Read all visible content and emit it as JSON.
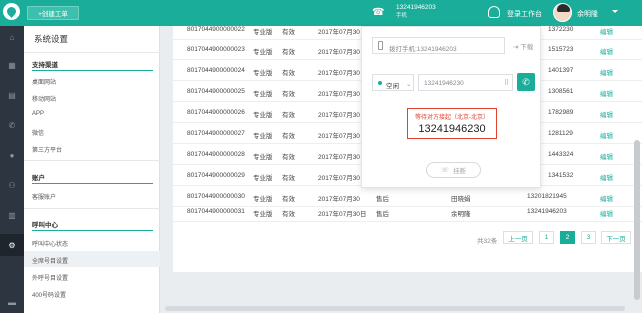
{
  "header": {
    "create_ticket": "+创建工单",
    "phone_number": "13241946203",
    "phone_sub": "手机",
    "login_workbench": "登录工作台",
    "username": "余明隆"
  },
  "settings": {
    "title": "系统设置",
    "sections": [
      {
        "label": "支持渠道",
        "items": [
          "桌面网站",
          "移动网站",
          "APP",
          "微信",
          "第三方平台"
        ]
      },
      {
        "label": "账户",
        "items": [
          "客服账户"
        ]
      },
      {
        "label": "呼叫中心",
        "items": [
          "呼叫中心状态",
          "全席号目设置",
          "外呼号目设置",
          "400号码设置"
        ]
      }
    ]
  },
  "table": {
    "rows": [
      {
        "id": "8017044900000022",
        "edition": "专业版",
        "status": "有效",
        "date": "2017年07月30日",
        "channel": "",
        "owner": "",
        "phone": "1372230",
        "action": "编辑"
      },
      {
        "id": "8017044900000023",
        "edition": "专业版",
        "status": "有效",
        "date": "2017年07月30",
        "channel": "",
        "owner": "",
        "phone": "1515723",
        "action": "编辑"
      },
      {
        "id": "8017044900000024",
        "edition": "专业版",
        "status": "有效",
        "date": "2017年07月30",
        "channel": "",
        "owner": "",
        "phone": "1401397",
        "action": "编辑"
      },
      {
        "id": "8017044900000025",
        "edition": "专业版",
        "status": "有效",
        "date": "2017年07月30",
        "channel": "",
        "owner": "",
        "phone": "1308561",
        "action": "编辑"
      },
      {
        "id": "8017044900000026",
        "edition": "专业版",
        "status": "有效",
        "date": "2017年07月30",
        "channel": "",
        "owner": "",
        "phone": "1782989",
        "action": "编辑"
      },
      {
        "id": "8017044900000027",
        "edition": "专业版",
        "status": "有效",
        "date": "2017年07月30",
        "channel": "",
        "owner": "",
        "phone": "1281129",
        "action": "编辑"
      },
      {
        "id": "8017044900000028",
        "edition": "专业版",
        "status": "有效",
        "date": "2017年07月30",
        "channel": "",
        "owner": "",
        "phone": "1443324",
        "action": "编辑"
      },
      {
        "id": "8017044900000029",
        "edition": "专业版",
        "status": "有效",
        "date": "2017年07月30",
        "channel": "",
        "owner": "",
        "phone": "1341532",
        "action": "编辑"
      },
      {
        "id": "8017044900000030",
        "edition": "专业版",
        "status": "有效",
        "date": "2017年07月30",
        "channel": "售后",
        "owner": "田晓娟",
        "phone": "13201821945",
        "action": "编辑"
      },
      {
        "id": "8017044900000031",
        "edition": "专业版",
        "status": "有效",
        "date": "2017年07月30日",
        "channel": "售后",
        "owner": "余明隆",
        "phone": "13241946203",
        "action": "编辑"
      }
    ]
  },
  "pagination": {
    "total": "共32条",
    "prev": "上一页",
    "pages": [
      "1",
      "2",
      "3"
    ],
    "current": "2",
    "next": "下一页"
  },
  "dialer": {
    "phone_placeholder": "拨打手机:13241946203",
    "download": "下载",
    "status_label": "空闲",
    "number_input": "13241946230",
    "calling_hint": "等待对方接起（北京-北京）",
    "calling_number": "13241946230",
    "hangup": "挂断"
  }
}
